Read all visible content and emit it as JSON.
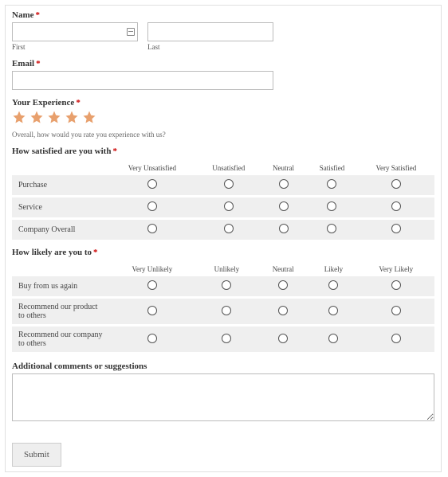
{
  "name": {
    "label": "Name",
    "first_sublabel": "First",
    "last_sublabel": "Last"
  },
  "email": {
    "label": "Email"
  },
  "experience": {
    "label": "Your Experience",
    "help": "Overall, how would you rate you experience with us?"
  },
  "satisfaction": {
    "label": "How satisfied are you with",
    "headers": {
      "h1": "Very Unsatisfied",
      "h2": "Unsatisfied",
      "h3": "Neutral",
      "h4": "Satisfied",
      "h5": "Very Satisfied"
    },
    "rows": {
      "r1": "Purchase",
      "r2": "Service",
      "r3": "Company Overall"
    }
  },
  "likelihood": {
    "label": "How likely are you to",
    "headers": {
      "h1": "Very Unlikely",
      "h2": "Unlikely",
      "h3": "Neutral",
      "h4": "Likely",
      "h5": "Very Likely"
    },
    "rows": {
      "r1": "Buy from us again",
      "r2": "Recommend our product to others",
      "r3": "Recommend our company to others"
    }
  },
  "comments": {
    "label": "Additional comments or suggestions"
  },
  "submit": {
    "label": "Submit"
  },
  "star_color": "#e8a06d"
}
